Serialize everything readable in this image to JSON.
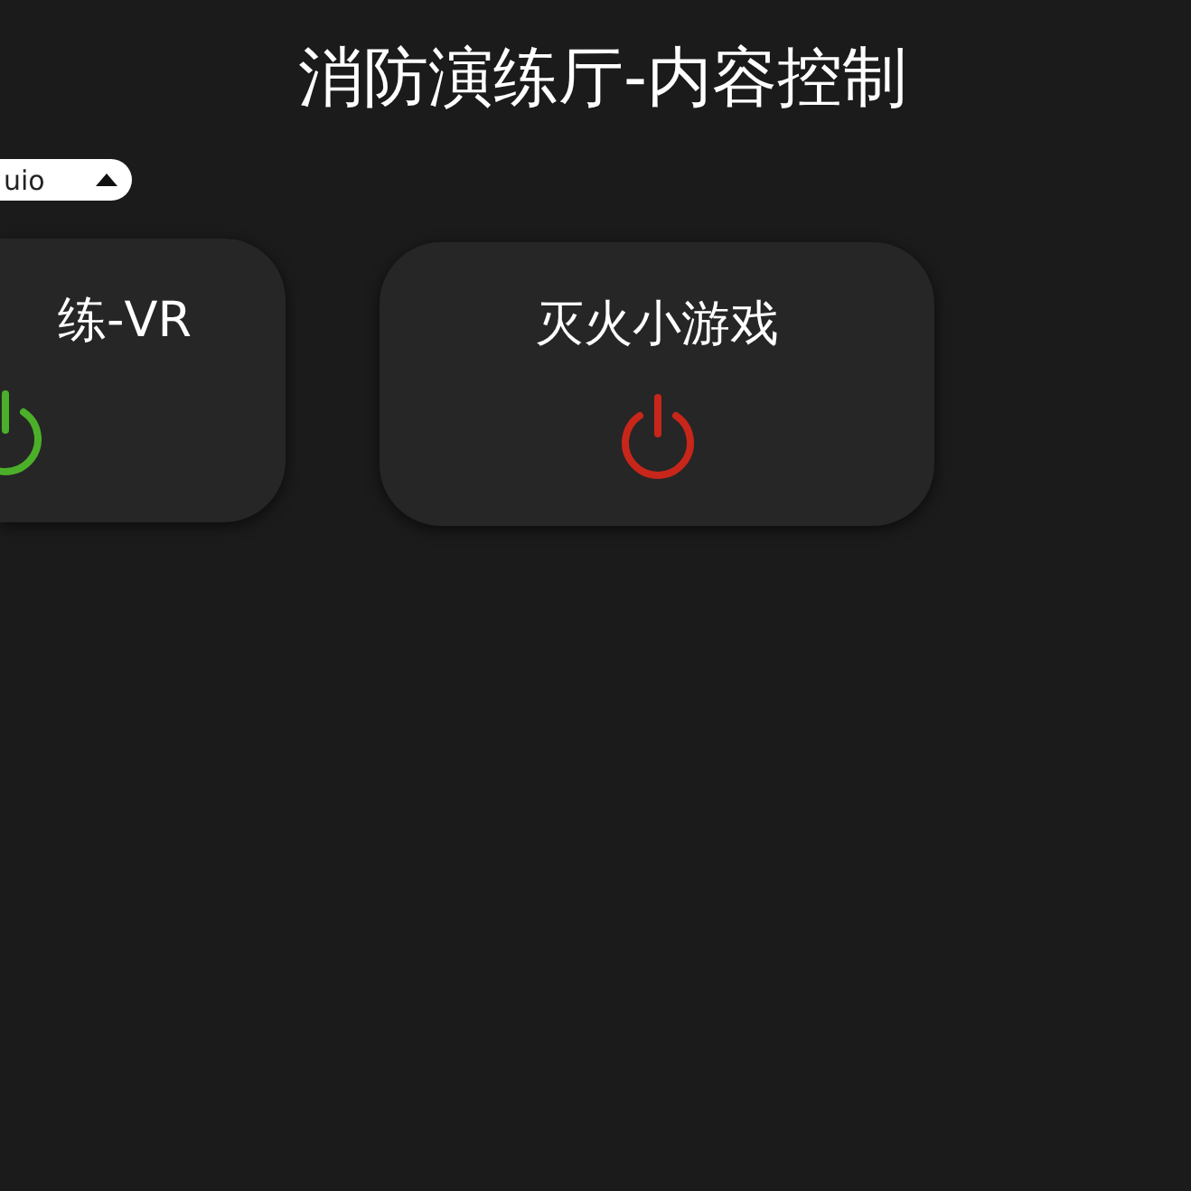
{
  "title": "消防演练厅-内容控制",
  "selector": {
    "value": "uio"
  },
  "cards": [
    {
      "label": "练-VR",
      "on": true
    },
    {
      "label": "灭火小游戏",
      "on": false
    }
  ]
}
